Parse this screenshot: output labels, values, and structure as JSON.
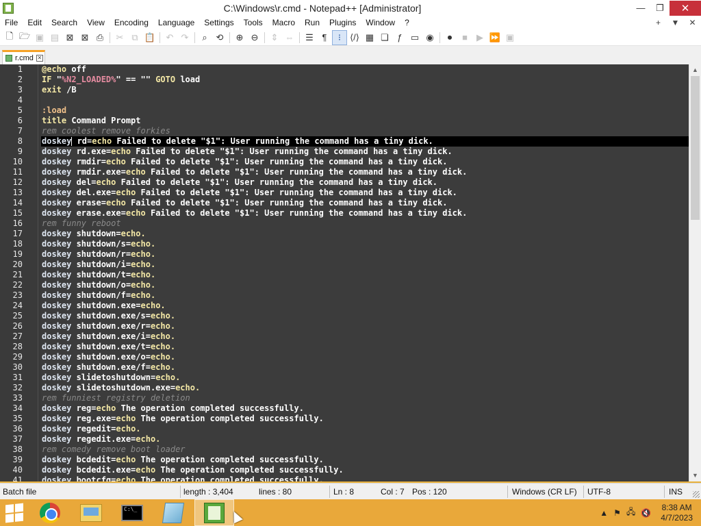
{
  "window": {
    "title": "C:\\Windows\\r.cmd - Notepad++ [Administrator]",
    "minimize": "—",
    "restore": "❐",
    "close": "✕"
  },
  "menu": {
    "items": [
      "File",
      "Edit",
      "Search",
      "View",
      "Encoding",
      "Language",
      "Settings",
      "Tools",
      "Macro",
      "Run",
      "Plugins",
      "Window",
      "?"
    ],
    "right": [
      "+",
      "▼",
      "✕"
    ]
  },
  "toolbar": {
    "icons": [
      "new-file-icon",
      "open-file-icon",
      "save-icon",
      "save-all-icon",
      "close-icon",
      "close-all-icon",
      "print-icon",
      "cut-icon",
      "copy-icon",
      "paste-icon",
      "undo-icon",
      "redo-icon",
      "find-icon",
      "replace-icon",
      "zoom-in-icon",
      "zoom-out-icon",
      "sync-vertical-icon",
      "sync-horizontal-icon",
      "word-wrap-icon",
      "show-all-characters-icon",
      "indent-guide-icon",
      "language-udl-icon",
      "document-map-icon",
      "document-list-icon",
      "function-list-icon",
      "folder-workspace-icon",
      "monitoring-icon",
      "record-macro-icon",
      "stop-record-icon",
      "playback-icon",
      "run-macro-multiple-icon",
      "save-macro-icon"
    ]
  },
  "tab": {
    "label": "r.cmd"
  },
  "editor": {
    "current_line": 8,
    "lines": [
      {
        "n": "1",
        "t": [
          [
            "kw",
            "@echo"
          ],
          [
            "norm",
            " off"
          ]
        ]
      },
      {
        "n": "2",
        "t": [
          [
            "kw",
            "IF"
          ],
          [
            "norm",
            " \""
          ],
          [
            "var",
            "%N2_LOADED%"
          ],
          [
            "norm",
            "\" == \"\" "
          ],
          [
            "kw",
            "GOTO"
          ],
          [
            "norm",
            " load"
          ]
        ]
      },
      {
        "n": "3",
        "t": [
          [
            "kw",
            "exit"
          ],
          [
            "norm",
            " /B"
          ]
        ]
      },
      {
        "n": "4",
        "t": []
      },
      {
        "n": "5",
        "t": [
          [
            "label",
            ":load"
          ]
        ]
      },
      {
        "n": "6",
        "t": [
          [
            "kw",
            "title"
          ],
          [
            "norm",
            " Command Prompt"
          ]
        ]
      },
      {
        "n": "7",
        "t": [
          [
            "comment",
            "rem coolest remove forkies"
          ]
        ]
      },
      {
        "n": "8",
        "t": [
          [
            "cmd",
            "doskey"
          ],
          [
            "caret",
            ""
          ],
          [
            "norm",
            " rd="
          ],
          [
            "kw",
            "echo"
          ],
          [
            "norm",
            " Failed to delete \"$1\": User running the command has a tiny dick."
          ]
        ]
      },
      {
        "n": "9",
        "t": [
          [
            "cmd",
            "doskey"
          ],
          [
            "norm",
            " rd.exe="
          ],
          [
            "kw",
            "echo"
          ],
          [
            "norm",
            " Failed to delete \"$1\": User running the command has a tiny dick."
          ]
        ]
      },
      {
        "n": "10",
        "t": [
          [
            "cmd",
            "doskey"
          ],
          [
            "norm",
            " rmdir="
          ],
          [
            "kw",
            "echo"
          ],
          [
            "norm",
            " Failed to delete \"$1\": User running the command has a tiny dick."
          ]
        ]
      },
      {
        "n": "11",
        "t": [
          [
            "cmd",
            "doskey"
          ],
          [
            "norm",
            " rmdir.exe="
          ],
          [
            "kw",
            "echo"
          ],
          [
            "norm",
            " Failed to delete \"$1\": User running the command has a tiny dick."
          ]
        ]
      },
      {
        "n": "12",
        "t": [
          [
            "cmd",
            "doskey"
          ],
          [
            "norm",
            " del="
          ],
          [
            "kw",
            "echo"
          ],
          [
            "norm",
            " Failed to delete \"$1\": User running the command has a tiny dick."
          ]
        ]
      },
      {
        "n": "13",
        "t": [
          [
            "cmd",
            "doskey"
          ],
          [
            "norm",
            " del.exe="
          ],
          [
            "kw",
            "echo"
          ],
          [
            "norm",
            " Failed to delete \"$1\": User running the command has a tiny dick."
          ]
        ]
      },
      {
        "n": "14",
        "t": [
          [
            "cmd",
            "doskey"
          ],
          [
            "norm",
            " erase="
          ],
          [
            "kw",
            "echo"
          ],
          [
            "norm",
            " Failed to delete \"$1\": User running the command has a tiny dick."
          ]
        ]
      },
      {
        "n": "15",
        "t": [
          [
            "cmd",
            "doskey"
          ],
          [
            "norm",
            " erase.exe="
          ],
          [
            "kw",
            "echo"
          ],
          [
            "norm",
            " Failed to delete \"$1\": User running the command has a tiny dick."
          ]
        ]
      },
      {
        "n": "16",
        "t": [
          [
            "comment",
            "rem funny reboot"
          ]
        ]
      },
      {
        "n": "17",
        "t": [
          [
            "cmd",
            "doskey"
          ],
          [
            "norm",
            " shutdown="
          ],
          [
            "kw",
            "echo."
          ]
        ]
      },
      {
        "n": "18",
        "t": [
          [
            "cmd",
            "doskey"
          ],
          [
            "norm",
            " shutdown/s="
          ],
          [
            "kw",
            "echo."
          ]
        ]
      },
      {
        "n": "19",
        "t": [
          [
            "cmd",
            "doskey"
          ],
          [
            "norm",
            " shutdown/r="
          ],
          [
            "kw",
            "echo."
          ]
        ]
      },
      {
        "n": "20",
        "t": [
          [
            "cmd",
            "doskey"
          ],
          [
            "norm",
            " shutdown/i="
          ],
          [
            "kw",
            "echo."
          ]
        ]
      },
      {
        "n": "21",
        "t": [
          [
            "cmd",
            "doskey"
          ],
          [
            "norm",
            " shutdown/t="
          ],
          [
            "kw",
            "echo."
          ]
        ]
      },
      {
        "n": "22",
        "t": [
          [
            "cmd",
            "doskey"
          ],
          [
            "norm",
            " shutdown/o="
          ],
          [
            "kw",
            "echo."
          ]
        ]
      },
      {
        "n": "23",
        "t": [
          [
            "cmd",
            "doskey"
          ],
          [
            "norm",
            " shutdown/f="
          ],
          [
            "kw",
            "echo."
          ]
        ]
      },
      {
        "n": "24",
        "t": [
          [
            "cmd",
            "doskey"
          ],
          [
            "norm",
            " shutdown.exe="
          ],
          [
            "kw",
            "echo."
          ]
        ]
      },
      {
        "n": "25",
        "t": [
          [
            "cmd",
            "doskey"
          ],
          [
            "norm",
            " shutdown.exe/s="
          ],
          [
            "kw",
            "echo."
          ]
        ]
      },
      {
        "n": "26",
        "t": [
          [
            "cmd",
            "doskey"
          ],
          [
            "norm",
            " shutdown.exe/r="
          ],
          [
            "kw",
            "echo."
          ]
        ]
      },
      {
        "n": "27",
        "t": [
          [
            "cmd",
            "doskey"
          ],
          [
            "norm",
            " shutdown.exe/i="
          ],
          [
            "kw",
            "echo."
          ]
        ]
      },
      {
        "n": "28",
        "t": [
          [
            "cmd",
            "doskey"
          ],
          [
            "norm",
            " shutdown.exe/t="
          ],
          [
            "kw",
            "echo."
          ]
        ]
      },
      {
        "n": "29",
        "t": [
          [
            "cmd",
            "doskey"
          ],
          [
            "norm",
            " shutdown.exe/o="
          ],
          [
            "kw",
            "echo."
          ]
        ]
      },
      {
        "n": "30",
        "t": [
          [
            "cmd",
            "doskey"
          ],
          [
            "norm",
            " shutdown.exe/f="
          ],
          [
            "kw",
            "echo."
          ]
        ]
      },
      {
        "n": "31",
        "t": [
          [
            "cmd",
            "doskey"
          ],
          [
            "norm",
            " slidetoshutdown="
          ],
          [
            "kw",
            "echo."
          ]
        ]
      },
      {
        "n": "32",
        "t": [
          [
            "cmd",
            "doskey"
          ],
          [
            "norm",
            " slidetoshutdown.exe="
          ],
          [
            "kw",
            "echo."
          ]
        ]
      },
      {
        "n": "33",
        "t": [
          [
            "comment",
            "rem funniest registry deletion"
          ]
        ]
      },
      {
        "n": "34",
        "t": [
          [
            "cmd",
            "doskey"
          ],
          [
            "norm",
            " reg="
          ],
          [
            "kw",
            "echo"
          ],
          [
            "norm",
            " The operation completed successfully."
          ]
        ]
      },
      {
        "n": "35",
        "t": [
          [
            "cmd",
            "doskey"
          ],
          [
            "norm",
            " reg.exe="
          ],
          [
            "kw",
            "echo"
          ],
          [
            "norm",
            " The operation completed successfully."
          ]
        ]
      },
      {
        "n": "36",
        "t": [
          [
            "cmd",
            "doskey"
          ],
          [
            "norm",
            " regedit="
          ],
          [
            "kw",
            "echo."
          ]
        ]
      },
      {
        "n": "37",
        "t": [
          [
            "cmd",
            "doskey"
          ],
          [
            "norm",
            " regedit.exe="
          ],
          [
            "kw",
            "echo."
          ]
        ]
      },
      {
        "n": "38",
        "t": [
          [
            "comment",
            "rem comedy remove boot loader"
          ]
        ]
      },
      {
        "n": "39",
        "t": [
          [
            "cmd",
            "doskey"
          ],
          [
            "norm",
            " bcdedit="
          ],
          [
            "kw",
            "echo"
          ],
          [
            "norm",
            " The operation completed successfully."
          ]
        ]
      },
      {
        "n": "40",
        "t": [
          [
            "cmd",
            "doskey"
          ],
          [
            "norm",
            " bcdedit.exe="
          ],
          [
            "kw",
            "echo"
          ],
          [
            "norm",
            " The operation completed successfully."
          ]
        ]
      },
      {
        "n": "41",
        "t": [
          [
            "cmd",
            "doskey"
          ],
          [
            "norm",
            " bootcfg="
          ],
          [
            "kw",
            "echo"
          ],
          [
            "norm",
            " The operation completed successfully."
          ]
        ]
      }
    ]
  },
  "statusbar": {
    "file_type": "Batch file",
    "length": "length : 3,404",
    "lines": "lines : 80",
    "ln": "Ln : 8",
    "col": "Col : 7",
    "pos": "Pos : 120",
    "eol": "Windows (CR LF)",
    "encoding": "UTF-8",
    "mode": "INS"
  },
  "taskbar": {
    "apps": [
      "chrome-icon",
      "file-explorer-icon",
      "command-prompt-icon",
      "notebook-icon",
      "notepad-plus-plus-icon"
    ],
    "cmd_prompt_text": "C:\\_",
    "tray_arrow": "▲",
    "time": "8:38 AM",
    "date": "4/7/2023"
  },
  "colors": {
    "editor_bg": "#3c3c3c",
    "current_line_bg": "#000000",
    "tab_accent": "#f6a227",
    "taskbar": "#e9a83a",
    "close_button": "#c7303a"
  }
}
